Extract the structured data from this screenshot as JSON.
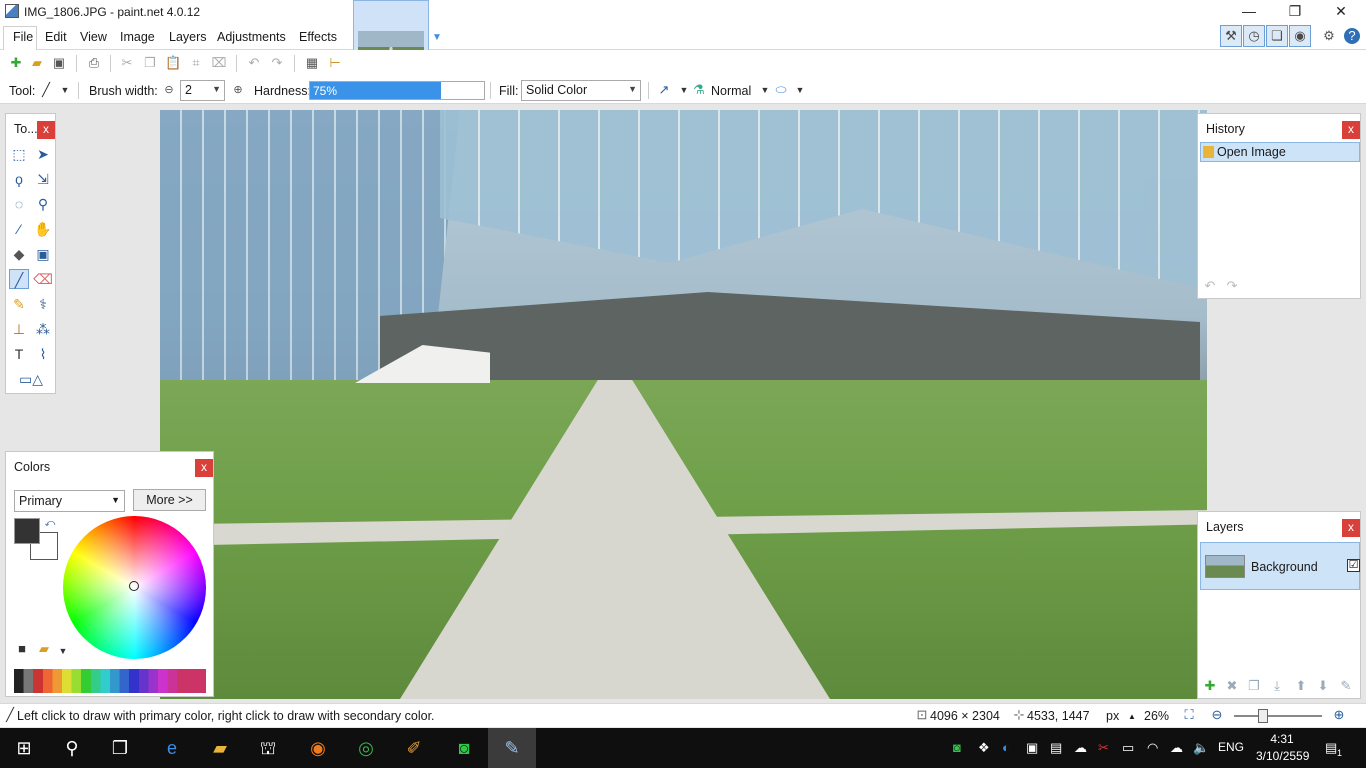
{
  "window": {
    "title": "IMG_1806.JPG - paint.net 4.0.12",
    "minimize": "—",
    "restore": "❐",
    "close": "✕"
  },
  "menu": [
    "File",
    "Edit",
    "View",
    "Image",
    "Layers",
    "Adjustments",
    "Effects"
  ],
  "toolbar": {
    "tool_label": "Tool:",
    "brush_width_label": "Brush width:",
    "brush_width_value": "2",
    "hardness_label": "Hardness:",
    "hardness_value": "75%",
    "hardness_fraction": 0.75,
    "fill_label": "Fill:",
    "fill_value": "Solid Color",
    "blend_mode": "Normal"
  },
  "panels": {
    "tools": {
      "title": "To...",
      "close": "x"
    },
    "history": {
      "title": "History",
      "close": "x",
      "items": [
        "Open Image"
      ]
    },
    "layers": {
      "title": "Layers",
      "close": "x",
      "items": [
        {
          "name": "Background",
          "visible": "☑"
        }
      ]
    },
    "colors": {
      "title": "Colors",
      "close": "x",
      "mode": "Primary",
      "more_button": "More >>"
    }
  },
  "status": {
    "hint": "Left click to draw with primary color, right click to draw with secondary color.",
    "image_size": "4096 × 2304",
    "cursor_pos": "4533, 1447",
    "units": "px",
    "zoom": "26%"
  },
  "taskbar": {
    "lang": "ENG",
    "time": "4:31",
    "date": "3/10/2559",
    "notifications": "1"
  },
  "colors": {
    "accent": "#3a93e8",
    "close_red": "#d9403a",
    "selection": "#cde3f8"
  }
}
